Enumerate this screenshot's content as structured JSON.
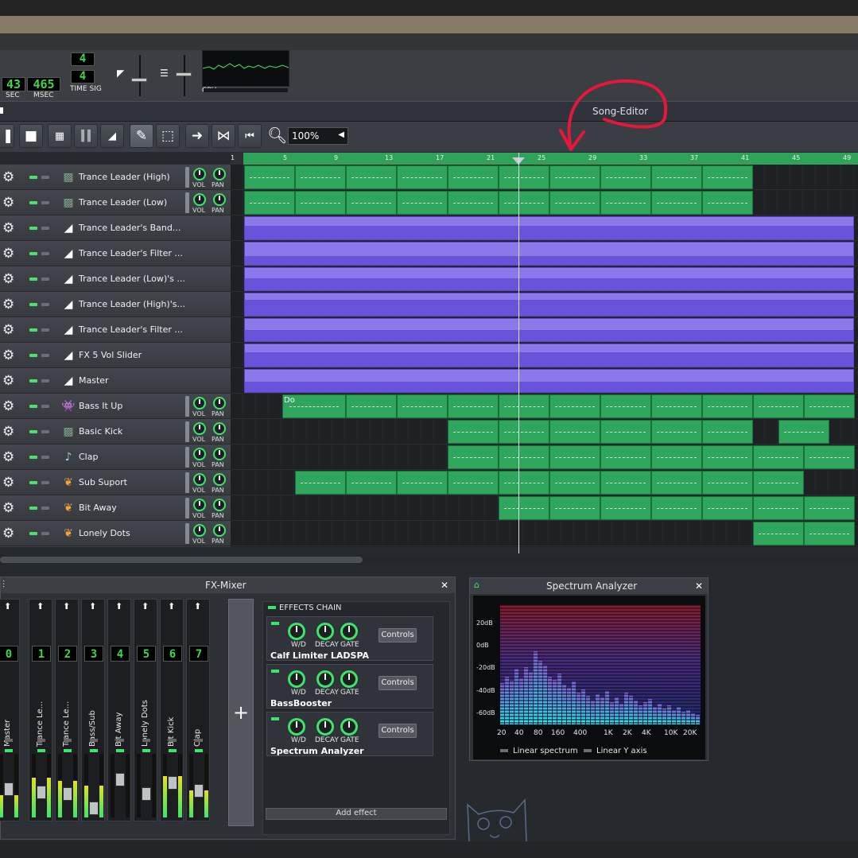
{
  "transport": {
    "sec_value": "43",
    "sec_label": "SEC",
    "msec_value": "465",
    "msec_label": "MSEC",
    "timesig_top": "4",
    "timesig_bottom": "4",
    "timesig_label": "TIME SIG",
    "cpu_label": "CPU"
  },
  "song_editor": {
    "title": "Song-Editor",
    "zoom": "100%",
    "timeline_ticks": [
      "1",
      "5",
      "9",
      "13",
      "17",
      "21",
      "25",
      "29",
      "33",
      "37",
      "41",
      "45",
      "49"
    ],
    "tracks": [
      {
        "name": "Trance Leader (High)",
        "icon": "instrument-sfxr-icon",
        "vol_label": "VOL",
        "pan_label": "PAN"
      },
      {
        "name": "Trance Leader (Low)",
        "icon": "instrument-sfxr-icon",
        "vol_label": "VOL",
        "pan_label": "PAN"
      },
      {
        "name": "Trance Leader's Band...",
        "icon": "automation-track-icon"
      },
      {
        "name": "Trance Leader's Filter ...",
        "icon": "automation-track-icon"
      },
      {
        "name": "Trance Leader (Low)'s ...",
        "icon": "automation-track-icon"
      },
      {
        "name": "Trance Leader (High)'s...",
        "icon": "automation-track-icon"
      },
      {
        "name": "Trance Leader's Filter ...",
        "icon": "automation-track-icon"
      },
      {
        "name": "FX 5 Vol Slider",
        "icon": "automation-track-icon"
      },
      {
        "name": "Master",
        "icon": "automation-track-icon"
      },
      {
        "name": "Bass It Up",
        "icon": "instrument-sid-icon",
        "vol_label": "VOL",
        "pan_label": "PAN",
        "clip_label": "Do"
      },
      {
        "name": "Basic Kick",
        "icon": "instrument-sfxr-icon",
        "vol_label": "VOL",
        "pan_label": "PAN"
      },
      {
        "name": "Clap",
        "icon": "instrument-sample-icon",
        "vol_label": "VOL",
        "pan_label": "PAN"
      },
      {
        "name": "Sub Suport",
        "icon": "instrument-triple-osc-icon",
        "vol_label": "VOL",
        "pan_label": "PAN"
      },
      {
        "name": "Bit Away",
        "icon": "instrument-triple-osc-icon",
        "vol_label": "VOL",
        "pan_label": "PAN"
      },
      {
        "name": "Lonely Dots",
        "icon": "instrument-triple-osc-icon",
        "vol_label": "VOL",
        "pan_label": "PAN"
      }
    ]
  },
  "fx_mixer": {
    "title": "FX-Mixer",
    "channels": [
      {
        "num": "0",
        "name": "Master",
        "level": 0.35
      },
      {
        "num": "1",
        "name": "Trance Le...",
        "level": 0.62
      },
      {
        "num": "2",
        "name": "Trance Le...",
        "level": 0.58
      },
      {
        "num": "3",
        "name": "Bass/Sub",
        "level": 0.5
      },
      {
        "num": "4",
        "name": "Bit Away",
        "level": 0.0
      },
      {
        "num": "5",
        "name": "Lonely Dots",
        "level": 0.0
      },
      {
        "num": "6",
        "name": "Bit Kick",
        "level": 0.65
      },
      {
        "num": "7",
        "name": "Clap",
        "level": 0.42
      }
    ],
    "effects_chain_label": "EFFECTS CHAIN",
    "effects": [
      {
        "name": "Calf Limiter LADSPA",
        "knobs": [
          "W/D",
          "DECAY",
          "GATE"
        ],
        "button": "Controls"
      },
      {
        "name": "BassBooster",
        "knobs": [
          "W/D",
          "DECAY",
          "GATE"
        ],
        "button": "Controls"
      },
      {
        "name": "Spectrum Analyzer",
        "knobs": [
          "W/D",
          "DECAY",
          "GATE"
        ],
        "button": "Controls"
      }
    ],
    "add_effect": "Add effect"
  },
  "spectrum": {
    "title": "Spectrum Analyzer",
    "db_labels": [
      "20dB",
      "0dB",
      "-20dB",
      "-40dB",
      "-60dB"
    ],
    "freq_labels": [
      "20",
      "40",
      "80",
      "160",
      "400",
      "1K",
      "2K",
      "4K",
      "10K",
      "20K"
    ],
    "opt_linear_spectrum": "Linear spectrum",
    "opt_linear_y": "Linear Y axis"
  },
  "colors": {
    "pattern_green": "#2ea65b",
    "automation_purple": "#8c78e8",
    "accent_green": "#3be56b",
    "annotation_red": "#e5173a"
  }
}
